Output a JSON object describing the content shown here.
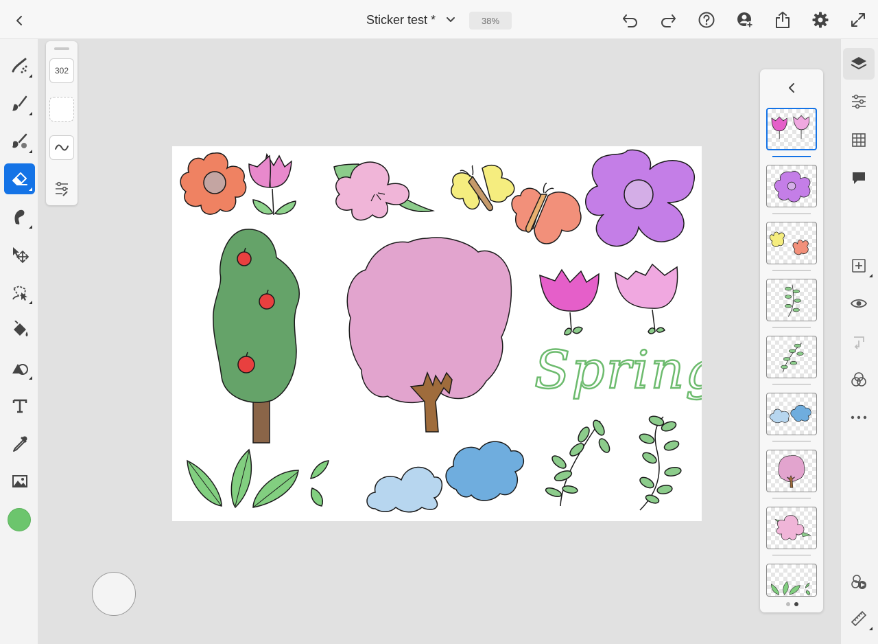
{
  "header": {
    "document_title": "Sticker test *",
    "zoom_level": "38%"
  },
  "properties_panel": {
    "brush_size": "302"
  },
  "canvas": {
    "artwork_text": "Spring"
  },
  "colors": {
    "accent": "#1473e6",
    "current_color": "#6cc56d",
    "canvas_background": "#ffffff",
    "workspace_background": "#e1e1e1"
  },
  "left_tools": [
    "paint-brush-tool-icon",
    "pixel-brush-tool-icon",
    "mixer-brush-tool-icon",
    "eraser-tool-icon",
    "smudge-tool-icon",
    "move-tool-icon",
    "lasso-selection-tool-icon",
    "fill-tool-icon",
    "shapes-tool-icon",
    "text-tool-icon",
    "eyedropper-tool-icon",
    "image-import-icon"
  ],
  "right_tools": [
    "layers-icon",
    "layer-properties-icon",
    "grid-icon",
    "comment-icon",
    "add-layer-icon",
    "visibility-icon",
    "merge-layer-icon",
    "blend-icon",
    "more-icon",
    "remix-icon",
    "ruler-icon"
  ],
  "layers": {
    "count_visible": 9,
    "pages": 2,
    "current_page": 2
  }
}
